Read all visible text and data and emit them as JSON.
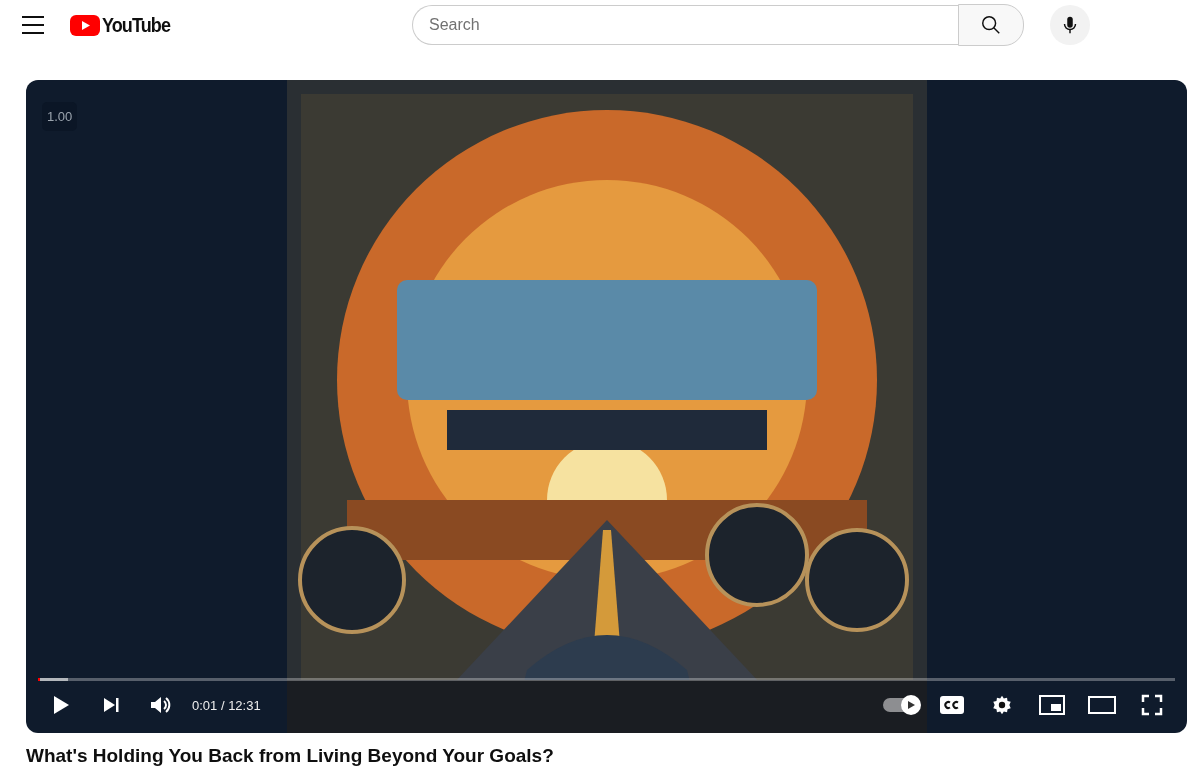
{
  "header": {
    "logo": "YouTube",
    "search": {
      "placeholder": "Search"
    }
  },
  "player": {
    "speed_badge": "1.00",
    "progress": {
      "level": 0.002
    },
    "time": "0:01 / 12:31",
    "autoplay": {
      "on": true
    }
  },
  "video": {
    "title": "What's Holding You Back from Living Beyond Your Goals?"
  }
}
